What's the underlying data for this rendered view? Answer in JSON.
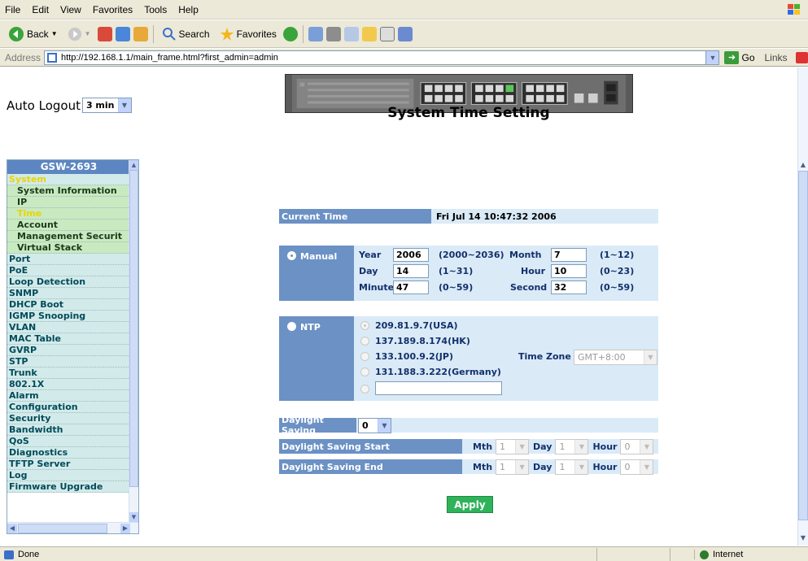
{
  "browser": {
    "menu": [
      "File",
      "Edit",
      "View",
      "Favorites",
      "Tools",
      "Help"
    ],
    "toolbar": {
      "back": "Back",
      "search": "Search",
      "favorites": "Favorites"
    },
    "address_label": "Address",
    "url": "http://192.168.1.1/main_frame.html?first_admin=admin",
    "go": "Go",
    "links": "Links",
    "status": "Done",
    "zone": "Internet"
  },
  "header": {
    "auto_logout_label": "Auto Logout",
    "auto_logout_value": "3 min"
  },
  "sidebar": {
    "title": "GSW-2693",
    "items": [
      {
        "label": "System",
        "type": "section-active"
      },
      {
        "label": "System Information",
        "type": "sub"
      },
      {
        "label": "IP",
        "type": "sub"
      },
      {
        "label": "Time",
        "type": "sub-active"
      },
      {
        "label": "Account",
        "type": "sub"
      },
      {
        "label": "Management Securit",
        "type": "sub"
      },
      {
        "label": "Virtual Stack",
        "type": "sub"
      },
      {
        "label": "Port",
        "type": "item"
      },
      {
        "label": "PoE",
        "type": "item"
      },
      {
        "label": "Loop Detection",
        "type": "item"
      },
      {
        "label": "SNMP",
        "type": "item"
      },
      {
        "label": "DHCP Boot",
        "type": "item"
      },
      {
        "label": "IGMP Snooping",
        "type": "item"
      },
      {
        "label": "VLAN",
        "type": "item"
      },
      {
        "label": "MAC Table",
        "type": "item"
      },
      {
        "label": "GVRP",
        "type": "item"
      },
      {
        "label": "STP",
        "type": "item"
      },
      {
        "label": "Trunk",
        "type": "item"
      },
      {
        "label": "802.1X",
        "type": "item"
      },
      {
        "label": "Alarm",
        "type": "item"
      },
      {
        "label": "Configuration",
        "type": "item"
      },
      {
        "label": "Security",
        "type": "item"
      },
      {
        "label": "Bandwidth",
        "type": "item"
      },
      {
        "label": "QoS",
        "type": "item"
      },
      {
        "label": "Diagnostics",
        "type": "item"
      },
      {
        "label": "TFTP Server",
        "type": "item"
      },
      {
        "label": "Log",
        "type": "item"
      },
      {
        "label": "Firmware Upgrade",
        "type": "item"
      }
    ]
  },
  "page": {
    "title": "System Time Setting",
    "current_time_label": "Current Time",
    "current_time_value": "Fri Jul 14 10:47:32 2006",
    "manual": {
      "label": "Manual",
      "selected": true,
      "year_label": "Year",
      "year": "2006",
      "year_range": "(2000~2036)",
      "month_label": "Month",
      "month": "7",
      "month_range": "(1~12)",
      "day_label": "Day",
      "day": "14",
      "day_range": "(1~31)",
      "hour_label": "Hour",
      "hour": "10",
      "hour_range": "(0~23)",
      "minute_label": "Minute",
      "minute": "47",
      "minute_range": "(0~59)",
      "second_label": "Second",
      "second": "32",
      "second_range": "(0~59)"
    },
    "ntp": {
      "label": "NTP",
      "selected": false,
      "servers": [
        "209.81.9.7(USA)",
        "137.189.8.174(HK)",
        "133.100.9.2(JP)",
        "131.188.3.222(Germany)"
      ],
      "custom_value": "",
      "time_zone_label": "Time Zone",
      "time_zone_value": "GMT+8:00"
    },
    "daylight": {
      "label": "Daylight Saving",
      "value": "0",
      "start_label": "Daylight Saving Start",
      "end_label": "Daylight Saving End",
      "mth_label": "Mth",
      "day_label": "Day",
      "hour_label": "Hour",
      "start": {
        "mth": "1",
        "day": "1",
        "hour": "0"
      },
      "end": {
        "mth": "1",
        "day": "1",
        "hour": "0"
      }
    },
    "apply": "Apply"
  },
  "colors": {
    "bar_blue": "#6b91c5",
    "light_blue": "#daeaf7",
    "apply_green": "#2fb35a",
    "active_yellow": "#e9d500"
  }
}
